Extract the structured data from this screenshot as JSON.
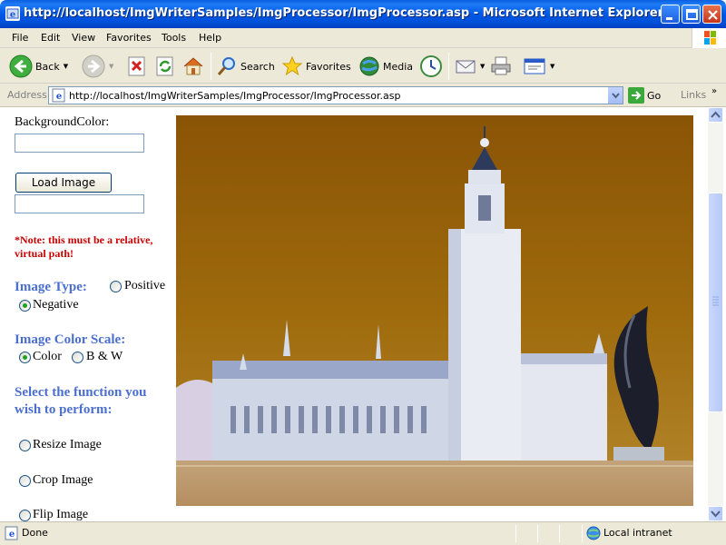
{
  "window": {
    "title": "http://localhost/ImgWriterSamples/ImgProcessor/ImgProcessor.asp - Microsoft Internet Explorer"
  },
  "menu": [
    "File",
    "Edit",
    "View",
    "Favorites",
    "Tools",
    "Help"
  ],
  "toolbar": {
    "back": "Back",
    "search": "Search",
    "favorites": "Favorites",
    "media": "Media"
  },
  "address": {
    "label": "Address",
    "url": "http://localhost/ImgWriterSamples/ImgProcessor/ImgProcessor.asp",
    "go": "Go",
    "links": "Links"
  },
  "form": {
    "background_color_label": "BackgroundColor:",
    "background_color_value": "",
    "load_image_button": "Load Image",
    "image_path_value": "",
    "note": "*Note: this must be a relative, virtual path!",
    "image_type_label": "Image Type:",
    "image_type_options": [
      "Positive",
      "Negative"
    ],
    "image_type_selected": "Negative",
    "color_scale_label": "Image Color Scale:",
    "color_scale_options": [
      "Color",
      "B & W"
    ],
    "color_scale_selected": "Color",
    "function_label": "Select the function you wish to perform:",
    "functions": [
      "Resize Image",
      "Crop Image",
      "Flip Image"
    ]
  },
  "status": {
    "text": "Done",
    "zone": "Local intranet"
  },
  "colors": {
    "title_blue": "#0058e6",
    "section_blue": "#4a6fd0",
    "note_red": "#cc0000",
    "image_sky": "#9a6208"
  }
}
